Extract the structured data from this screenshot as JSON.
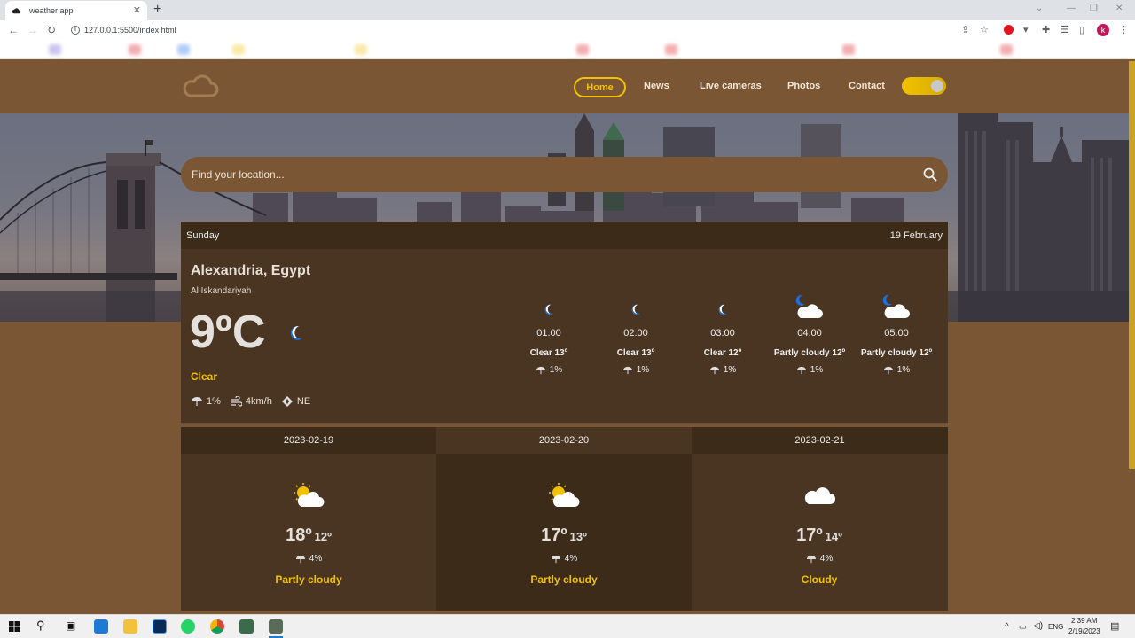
{
  "browser": {
    "tab_title": "weather app",
    "new_tab": "+",
    "url": "127.0.0.1:5500/index.html",
    "profile_initial": "k"
  },
  "site": {
    "nav": [
      "Home",
      "News",
      "Live cameras",
      "Photos",
      "Contact"
    ],
    "active_nav": "Home",
    "search_placeholder": "Find your location...",
    "colors": {
      "background": "#7a5634",
      "accent": "#f2c200",
      "card": "#4a3522",
      "card_header": "#3d2b1a"
    }
  },
  "current": {
    "day": "Sunday",
    "date": "19 February",
    "city": "Alexandria, Egypt",
    "region": "Al Iskandariyah",
    "temp": "9ºC",
    "condition": "Clear",
    "rain": "1%",
    "wind": "4km/h",
    "direction": "NE",
    "icon": "moon-icon"
  },
  "hourly": [
    {
      "time": "01:00",
      "condition": "Clear 13º",
      "rain": "1%",
      "icon": "moon-icon"
    },
    {
      "time": "02:00",
      "condition": "Clear 13º",
      "rain": "1%",
      "icon": "moon-icon"
    },
    {
      "time": "03:00",
      "condition": "Clear 12º",
      "rain": "1%",
      "icon": "moon-icon"
    },
    {
      "time": "04:00",
      "condition": "Partly cloudy 12º",
      "rain": "1%",
      "icon": "moon-cloud-icon"
    },
    {
      "time": "05:00",
      "condition": "Partly cloudy 12º",
      "rain": "1%",
      "icon": "moon-cloud-icon"
    }
  ],
  "daily": [
    {
      "date": "2023-02-19",
      "high": "18º",
      "low": "12º",
      "rain": "4%",
      "condition": "Partly cloudy",
      "icon": "sun-cloud-icon"
    },
    {
      "date": "2023-02-20",
      "high": "17º",
      "low": "13º",
      "rain": "4%",
      "condition": "Partly cloudy",
      "icon": "sun-cloud-icon"
    },
    {
      "date": "2023-02-21",
      "high": "17º",
      "low": "14º",
      "rain": "4%",
      "condition": "Cloudy",
      "icon": "cloud-icon"
    }
  ],
  "taskbar": {
    "language": "ENG",
    "time": "2:39 AM",
    "date": "2/19/2023"
  }
}
